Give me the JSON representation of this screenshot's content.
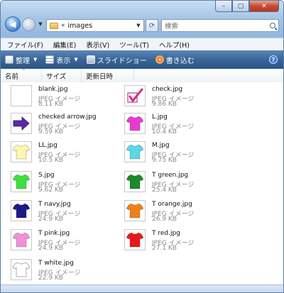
{
  "window": {
    "minimize_label": "–",
    "maximize_label": "▢",
    "close_label": "✕"
  },
  "address": {
    "chevron": "«",
    "path": "images"
  },
  "search": {
    "placeholder": "検索"
  },
  "menubar": [
    "ファイル(F)",
    "編集(E)",
    "表示(V)",
    "ツール(T)",
    "ヘルプ(H)"
  ],
  "toolbar": {
    "organize": "整理",
    "view": "表示",
    "slideshow": "スライドショー",
    "burn": "書き込む",
    "help_glyph": "?"
  },
  "columns": [
    "名前",
    "サイズ",
    "更新日時"
  ],
  "files": [
    {
      "name": "blank.jpg",
      "type": "JPEG イメージ",
      "size": "8.11 KB",
      "icon": "blank-thumbnail",
      "color": "#ffffff"
    },
    {
      "name": "check.jpg",
      "type": "JPEG イメージ",
      "size": "9.86 KB",
      "icon": "checkmark-thumbnail",
      "color": "#d0308c"
    },
    {
      "name": "checked arrow.jpg",
      "type": "JPEG イメージ",
      "size": "9.59 KB",
      "icon": "arrow-thumbnail",
      "color": "#5a2aa8"
    },
    {
      "name": "L.jpg",
      "type": "JPEG イメージ",
      "size": "10.4 KB",
      "icon": "tshirt-thumbnail",
      "color": "#e83ad0"
    },
    {
      "name": "LL.jpg",
      "type": "JPEG イメージ",
      "size": "10.5 KB",
      "icon": "tshirt-thumbnail",
      "color": "#fbf6b0"
    },
    {
      "name": "M.jpg",
      "type": "JPEG イメージ",
      "size": "9.75 KB",
      "icon": "tshirt-thumbnail",
      "color": "#5ad8e8"
    },
    {
      "name": "S.jpg",
      "type": "JPEG イメージ",
      "size": "9.62 KB",
      "icon": "tshirt-thumbnail",
      "color": "#3ee03e"
    },
    {
      "name": "T green.jpg",
      "type": "JPEG イメージ",
      "size": "25.4 KB",
      "icon": "tshirt-thumbnail",
      "color": "#1a8a2a"
    },
    {
      "name": "T navy.jpg",
      "type": "JPEG イメージ",
      "size": "24.9 KB",
      "icon": "tshirt-thumbnail",
      "color": "#1a1a8a"
    },
    {
      "name": "T orange.jpg",
      "type": "JPEG イメージ",
      "size": "26.9 KB",
      "icon": "tshirt-thumbnail",
      "color": "#f08018"
    },
    {
      "name": "T pink.jpg",
      "type": "JPEG イメージ",
      "size": "24.9 KB",
      "icon": "tshirt-thumbnail",
      "color": "#f090d8"
    },
    {
      "name": "T red.jpg",
      "type": "JPEG イメージ",
      "size": "27.1 KB",
      "icon": "tshirt-thumbnail",
      "color": "#e81818"
    },
    {
      "name": "T white.jpg",
      "type": "JPEG イメージ",
      "size": "22.9 KB",
      "icon": "tshirt-thumbnail",
      "color": "#ffffff"
    }
  ]
}
